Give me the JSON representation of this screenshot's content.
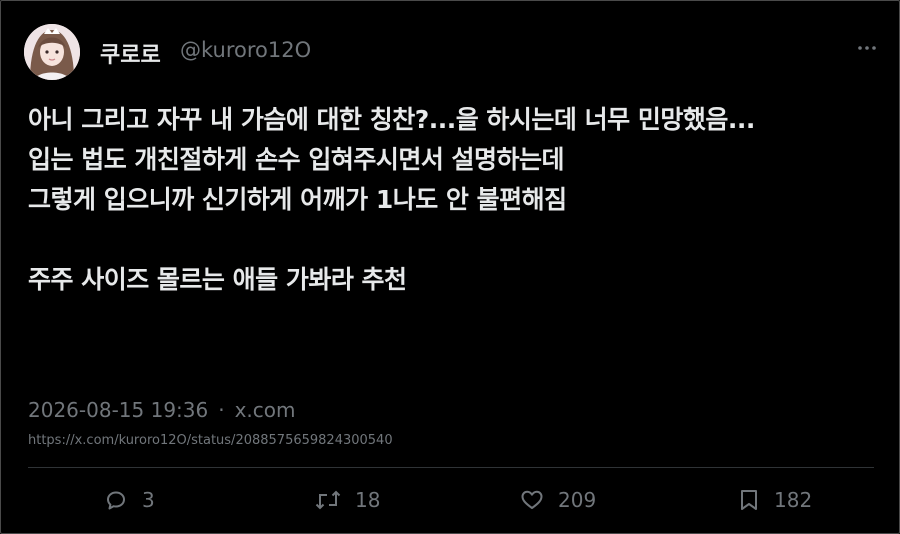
{
  "author": {
    "display_name": "쿠로로",
    "handle": "@kuroro12O"
  },
  "tweet": {
    "text": "아니 그리고 자꾸 내 가슴에 대한 칭찬?...을 하시는데 너무 민망했음...\n입는 법도 개친절하게 손수 입혀주시면서 설명하는데\n그렇게 입으니까 신기하게 어깨가 1나도 안 불편해짐\n\n주주 사이즈 몰르는 애들 가봐라 추천"
  },
  "meta": {
    "timestamp": "2026-08-15 19:36",
    "separator": "·",
    "source": "x.com",
    "url": "https://x.com/kuroro12O/status/2088575659824300540"
  },
  "actions": {
    "replies": "3",
    "reposts": "18",
    "likes": "209",
    "bookmarks": "182"
  },
  "icons": {
    "more": "more-icon",
    "reply": "reply-icon",
    "repost": "repost-icon",
    "like": "like-icon",
    "bookmark": "bookmark-icon"
  },
  "colors": {
    "background": "#000000",
    "text": "#e7e9ea",
    "secondary": "#71767b",
    "divider": "#2f3336"
  }
}
